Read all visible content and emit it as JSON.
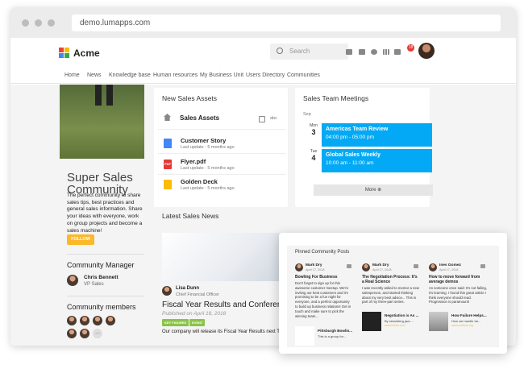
{
  "browser": {
    "url": "demo.lumapps.com"
  },
  "header": {
    "brand": "Acme",
    "search_placeholder": "Search",
    "notification_count": "18"
  },
  "nav": [
    "Home",
    "News",
    "Knowledge base",
    "Human resources",
    "My Business Unit",
    "Users Directory",
    "Communities"
  ],
  "community": {
    "title": "Super Sales Community",
    "description": "The perfect community to share sales tips, best practices and general sales information. Share your ideas with everyone, work on group projects and become a sales machine!",
    "follow_label": "FOLLOW",
    "manager_heading": "Community Manager",
    "manager_name": "Chris Bennett",
    "manager_role": "VP Sales",
    "members_heading": "Community members",
    "more_members": "..."
  },
  "assets": {
    "heading": "New Sales Assets",
    "folder_title": "Sales Assets",
    "folder_meta": "abc",
    "items": [
      {
        "title": "Customer Story",
        "meta": "Last update : 5 months ago",
        "color": "#4285f4",
        "glyph": ""
      },
      {
        "title": "Flyer.pdf",
        "meta": "Last update : 5 months ago",
        "color": "#e53935",
        "glyph": "PDF"
      },
      {
        "title": "Golden Deck",
        "meta": "Last update : 5 months ago",
        "color": "#fbbc05",
        "glyph": ""
      }
    ]
  },
  "meetings": {
    "heading": "Sales Team Meetings",
    "month": "Sep",
    "events": [
      {
        "weekday": "Mon",
        "day": "3",
        "title": "Americas Team Review",
        "time": "04:00 pm - 05:00 pm"
      },
      {
        "weekday": "Tue",
        "day": "4",
        "title": "Global Sales Weekly",
        "time": "10:00 am - 11:00 am"
      }
    ],
    "more_label": "More"
  },
  "news": {
    "heading": "Latest Sales News",
    "author": "Lisa Dunn",
    "author_role": "Chief Financial Officer",
    "title": "Fiscal Year Results and Conference",
    "published": "Published on April 18, 2018",
    "tags": [
      "KEY FIGURES",
      "EVENT"
    ],
    "excerpt": "Our company will release its Fiscal Year Results next Tues"
  },
  "pinned": {
    "heading": "Pinned Community Posts",
    "posts": [
      {
        "author": "Mark Dry",
        "date": "April 17, 2018",
        "title": "Bowling For Business",
        "body": "Don't forget to sign up for this awesome customer meetup. We're inviting our best customers and it's promising to be a fun night for everyone, and a perfect opportunity to build up business relations! Get in touch and make sure to pick the winning team...",
        "link_title": "Pittsburgh Bowlin...",
        "link_sub": "This is a group for...",
        "link_src": ""
      },
      {
        "author": "Mark Dry",
        "date": "April 17, 2018",
        "title": "The Negotiation Process: It's a Real Science",
        "body": "I was recently asked to mentor a new salesperson, and started thinking about my very best advice... This is part of my three-part series.",
        "link_title": "Negotiation is As ...",
        "link_sub": "By simulating jazz ...",
        "link_src": "www.forbes.com"
      },
      {
        "author": "Ines Gomez",
        "date": "April 17, 2018",
        "title": "How to move forward from average demos",
        "body": "As someone once said: It's not failing, it's learning. I found this great article I think everyone should read. Progression is paramount!",
        "link_title": "How Failure Helps...",
        "link_sub": "How we handle fai...",
        "link_src": "www.medium.org"
      }
    ]
  }
}
